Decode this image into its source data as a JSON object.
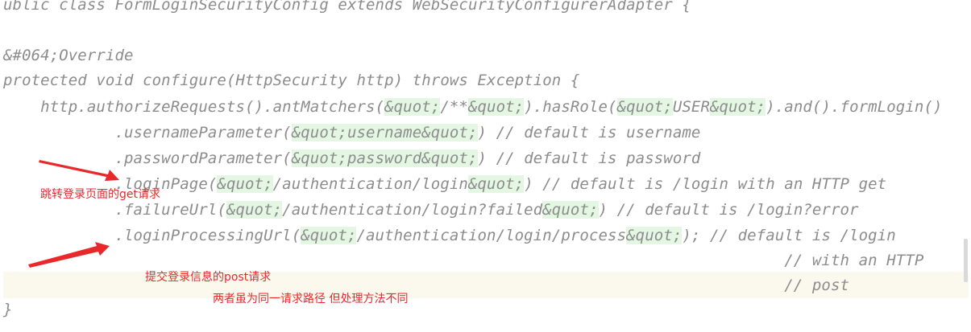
{
  "code": {
    "lines": [
      "ublic class FormLoginSecurityConfig extends WebSecurityConfigurerAdapter {",
      "",
      "",
      "",
      "",
      "",
      "",
      "",
      "",
      "",
      "",
      "",
      "}"
    ],
    "segments": {
      "l2_a": "&#064;Override",
      "l3_a": "protected void configure(HttpSecurity http) throws Exception {",
      "l4_a": "    http.authorizeRequests().antMatchers(",
      "l4_q1": "&quot;",
      "l4_b": "/**",
      "l4_q2": "&quot;",
      "l4_c": ").hasRole(",
      "l4_q3": "&quot;",
      "l4_d": "USER",
      "l4_q4": "&quot;",
      "l4_e": ").and().formLogin()",
      "l5_a": "            .usernameParameter(",
      "l5_q1": "&quot;",
      "l5_b": "username",
      "l5_q2": "&quot;",
      "l5_c": ") // default is username",
      "l6_a": "            .passwordParameter(",
      "l6_q1": "&quot;",
      "l6_b": "password",
      "l6_q2": "&quot;",
      "l6_c": ") // default is password",
      "l7_a": "            .loginPage(",
      "l7_q1": "&quot;",
      "l7_b": "/authentication/login",
      "l7_q2": "&quot;",
      "l7_c": ") // default is /login with an HTTP get",
      "l8_a": "            .failureUrl(",
      "l8_q1": "&quot;",
      "l8_b": "/authentication/login?failed",
      "l8_q2": "&quot;",
      "l8_c": ") // default is /login?error",
      "l9_a": "            .loginProcessingUrl(",
      "l9_q1": "&quot;",
      "l9_b": "/authentication/login/process",
      "l9_q2": "&quot;",
      "l9_c": "); // default is /login",
      "l10_a": "                                                                                    // with an HTTP",
      "l11_a": "                                                                                    // post"
    }
  },
  "annotations": {
    "get_note": "跳转登录页面的get请求",
    "post_note": "提交登录信息的post请求",
    "same_path_note": "两者虽为同一请求路径 但处理方法不同",
    "color": "#e8282b"
  },
  "colors": {
    "code_text": "#8c8c8c",
    "string_highlight": "#e3f7e3",
    "current_line": "#fbf9ee"
  }
}
